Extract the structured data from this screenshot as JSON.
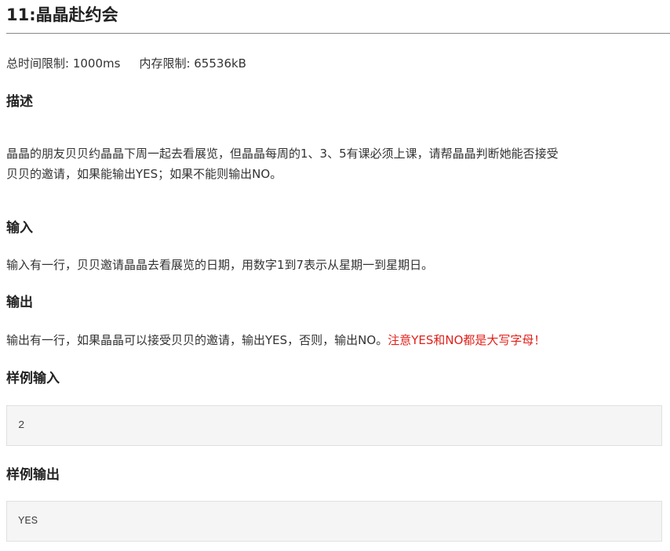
{
  "problem": {
    "title": "11:晶晶赴约会"
  },
  "limits": {
    "time_label": "总时间限制: ",
    "time_value": "1000ms",
    "memory_label": "内存限制: ",
    "memory_value": "65536kB"
  },
  "description": {
    "heading": "描述",
    "text_line1": "晶晶的朋友贝贝约晶晶下周一起去看展览，但晶晶每周的1、3、5有课必须上课，请帮晶晶判断她能否接受",
    "text_line2": "贝贝的邀请，如果能输出YES；如果不能则输出NO。"
  },
  "input": {
    "heading": "输入",
    "text": "输入有一行，贝贝邀请晶晶去看展览的日期，用数字1到7表示从星期一到星期日。"
  },
  "output": {
    "heading": "输出",
    "text": "输出有一行，如果晶晶可以接受贝贝的邀请，输出YES，否则，输出NO。",
    "warning": "注意YES和NO都是大写字母！",
    "warning_color": "#e0201a"
  },
  "sample_input": {
    "heading": "样例输入",
    "content": "2"
  },
  "sample_output": {
    "heading": "样例输出",
    "content": "YES"
  }
}
